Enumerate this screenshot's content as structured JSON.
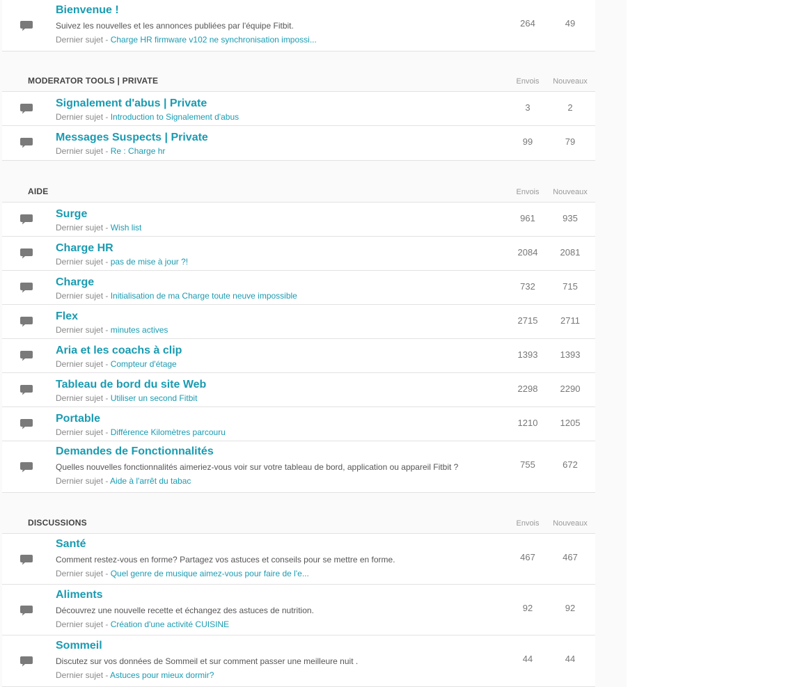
{
  "columns": {
    "envois": "Envois",
    "nouveaux": "Nouveaux"
  },
  "latest_prefix": "Dernier sujet - ",
  "colors": {
    "link": "#1a9bb1",
    "icon": "#7a7a7a"
  },
  "sections": [
    {
      "id": "top",
      "title": "",
      "show_columns": false,
      "boards": [
        {
          "title": "Bienvenue !",
          "description": "Suivez les nouvelles et les annonces publiées par l'équipe Fitbit.",
          "latest": "Charge HR firmware v102 ne synchronisation impossi...",
          "envois": "264",
          "nouveaux": "49"
        }
      ]
    },
    {
      "id": "moderator",
      "title": "MODERATOR TOOLS | PRIVATE",
      "show_columns": true,
      "boards": [
        {
          "title": "Signalement d'abus | Private",
          "description": "",
          "latest": "Introduction to Signalement d'abus",
          "envois": "3",
          "nouveaux": "2"
        },
        {
          "title": "Messages Suspects | Private",
          "description": "",
          "latest": "Re : Charge hr",
          "envois": "99",
          "nouveaux": "79"
        }
      ]
    },
    {
      "id": "aide",
      "title": "AIDE",
      "show_columns": true,
      "boards": [
        {
          "title": "Surge",
          "description": "",
          "latest": "Wish list",
          "envois": "961",
          "nouveaux": "935"
        },
        {
          "title": "Charge HR",
          "description": "",
          "latest": "pas de mise à jour ?!",
          "envois": "2084",
          "nouveaux": "2081"
        },
        {
          "title": "Charge",
          "description": "",
          "latest": "Initialisation de ma Charge toute neuve impossible",
          "envois": "732",
          "nouveaux": "715"
        },
        {
          "title": "Flex",
          "description": "",
          "latest": "minutes actives",
          "envois": "2715",
          "nouveaux": "2711"
        },
        {
          "title": "Aria et les coachs à clip",
          "description": "",
          "latest": "Compteur d'étage",
          "envois": "1393",
          "nouveaux": "1393"
        },
        {
          "title": "Tableau de bord du site Web",
          "description": "",
          "latest": "Utiliser un second Fitbit",
          "envois": "2298",
          "nouveaux": "2290"
        },
        {
          "title": "Portable",
          "description": "",
          "latest": "Différence Kilomètres parcouru",
          "envois": "1210",
          "nouveaux": "1205"
        },
        {
          "title": "Demandes de Fonctionnalités",
          "description": "Quelles nouvelles fonctionnalités aimeriez-vous voir sur votre tableau de bord, application ou appareil Fitbit ?",
          "latest": "Aide à l'arrêt du tabac",
          "envois": "755",
          "nouveaux": "672"
        }
      ]
    },
    {
      "id": "discussions",
      "title": "DISCUSSIONS",
      "show_columns": true,
      "boards": [
        {
          "title": "Santé",
          "description": "Comment restez-vous en forme? Partagez vos astuces et conseils pour se mettre en forme.",
          "latest": "Quel genre de musique aimez-vous pour faire de l'e...",
          "envois": "467",
          "nouveaux": "467"
        },
        {
          "title": "Aliments",
          "description": "Découvrez une nouvelle recette et échangez des astuces de nutrition.",
          "latest": "Création d'une activité CUISINE",
          "envois": "92",
          "nouveaux": "92"
        },
        {
          "title": "Sommeil",
          "description": "Discutez sur vos données de Sommeil et sur comment passer une meilleure nuit .",
          "latest": "Astuces pour mieux dormir?",
          "envois": "44",
          "nouveaux": "44"
        }
      ]
    }
  ]
}
